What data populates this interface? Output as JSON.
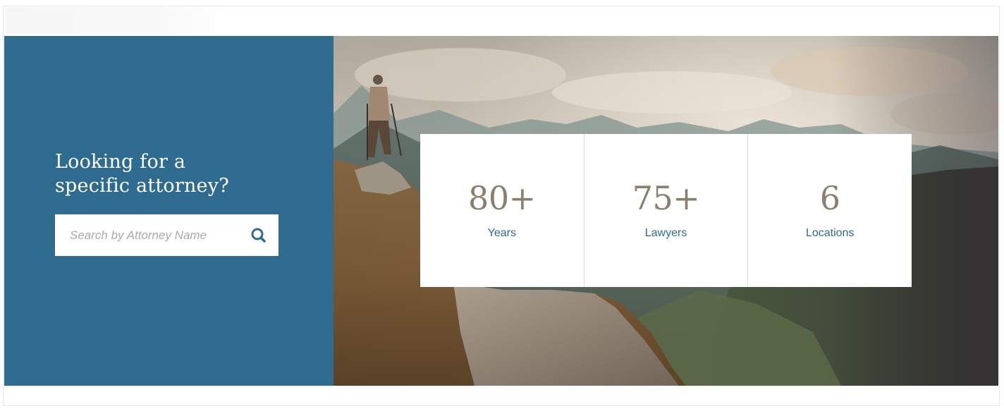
{
  "search": {
    "heading_line1": "Looking for a",
    "heading_line2": "specific attorney?",
    "placeholder": "Search by Attorney Name",
    "button_icon": "search-icon"
  },
  "stats": [
    {
      "value": "80+",
      "label": "Years"
    },
    {
      "value": "75+",
      "label": "Lawyers"
    },
    {
      "value": "6",
      "label": "Locations"
    }
  ],
  "hero_image": {
    "icon": "mountain-hiker-photo"
  },
  "colors": {
    "panel_blue": "#2f6b8f",
    "stat_number": "#8c7e6d",
    "stat_label": "#2f6b8f",
    "card_background": "#ffffff"
  }
}
